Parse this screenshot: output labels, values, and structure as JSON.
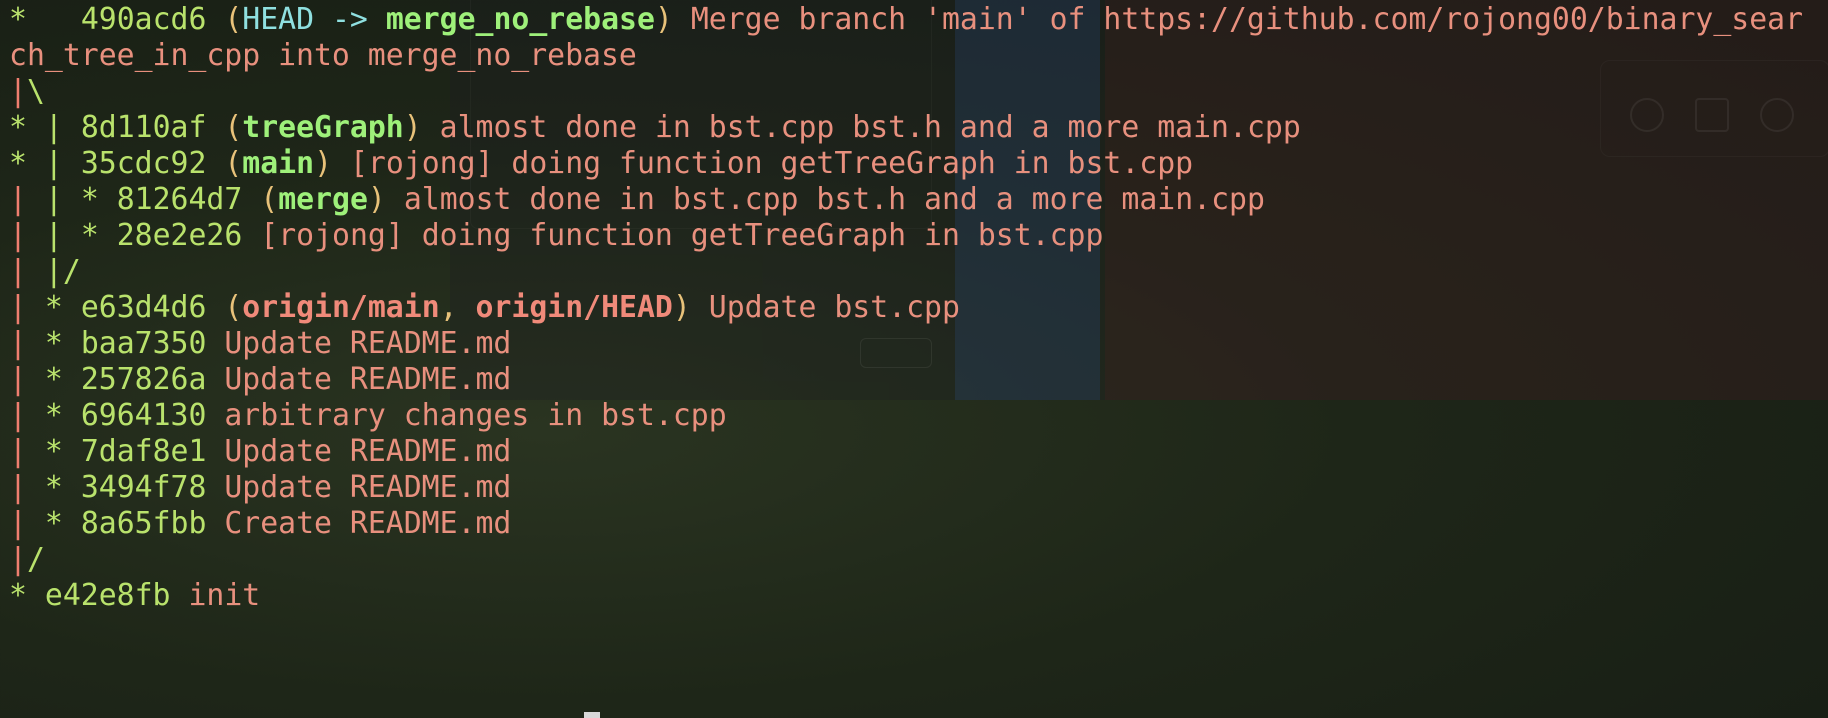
{
  "colors": {
    "graph": "#b9e26c",
    "graph_line": "#ef7e6f",
    "head": "#8fe0e0",
    "local_branch": "#9ef07a",
    "remote_branch": "#f08a7a",
    "message": "#e8907e",
    "paren": "#e8c27a"
  },
  "log": [
    {
      "graph": "*   ",
      "hash": "490acd6",
      "refs": [
        {
          "text": "HEAD -> ",
          "kind": "head"
        },
        {
          "text": "merge_no_rebase",
          "kind": "local"
        }
      ],
      "message": "Merge branch 'main' of https://github.com/rojong00/binary_sear"
    },
    {
      "graph": "",
      "hash": "",
      "refs": [],
      "message": "ch_tree_in_cpp into merge_no_rebase"
    },
    {
      "graph": "|\\",
      "hash": "",
      "refs": [],
      "message": ""
    },
    {
      "graph": "* | ",
      "hash": "8d110af",
      "refs": [
        {
          "text": "treeGraph",
          "kind": "local"
        }
      ],
      "message": "almost done in bst.cpp bst.h and a more main.cpp"
    },
    {
      "graph": "* | ",
      "hash": "35cdc92",
      "refs": [
        {
          "text": "main",
          "kind": "local"
        }
      ],
      "message": "[rojong] doing function getTreeGraph in bst.cpp"
    },
    {
      "graph": "| | * ",
      "hash": "81264d7",
      "refs": [
        {
          "text": "merge",
          "kind": "local"
        }
      ],
      "message": "almost done in bst.cpp bst.h and a more main.cpp"
    },
    {
      "graph": "| | * ",
      "hash": "28e2e26",
      "refs": [],
      "message": "[rojong] doing function getTreeGraph in bst.cpp"
    },
    {
      "graph": "| |/",
      "hash": "",
      "refs": [],
      "message": ""
    },
    {
      "graph": "| * ",
      "hash": "e63d4d6",
      "refs": [
        {
          "text": "origin/main",
          "kind": "remote"
        },
        {
          "text": "origin/HEAD",
          "kind": "remote"
        }
      ],
      "message": "Update bst.cpp"
    },
    {
      "graph": "| * ",
      "hash": "baa7350",
      "refs": [],
      "message": "Update README.md"
    },
    {
      "graph": "| * ",
      "hash": "257826a",
      "refs": [],
      "message": "Update README.md"
    },
    {
      "graph": "| * ",
      "hash": "6964130",
      "refs": [],
      "message": "arbitrary changes in bst.cpp"
    },
    {
      "graph": "| * ",
      "hash": "7daf8e1",
      "refs": [],
      "message": "Update README.md"
    },
    {
      "graph": "| * ",
      "hash": "3494f78",
      "refs": [],
      "message": "Update README.md"
    },
    {
      "graph": "| * ",
      "hash": "8a65fbb",
      "refs": [],
      "message": "Create README.md"
    },
    {
      "graph": "|/",
      "hash": "",
      "refs": [],
      "message": ""
    },
    {
      "graph": "* ",
      "hash": "e42e8fb",
      "refs": [],
      "message": "init"
    }
  ]
}
